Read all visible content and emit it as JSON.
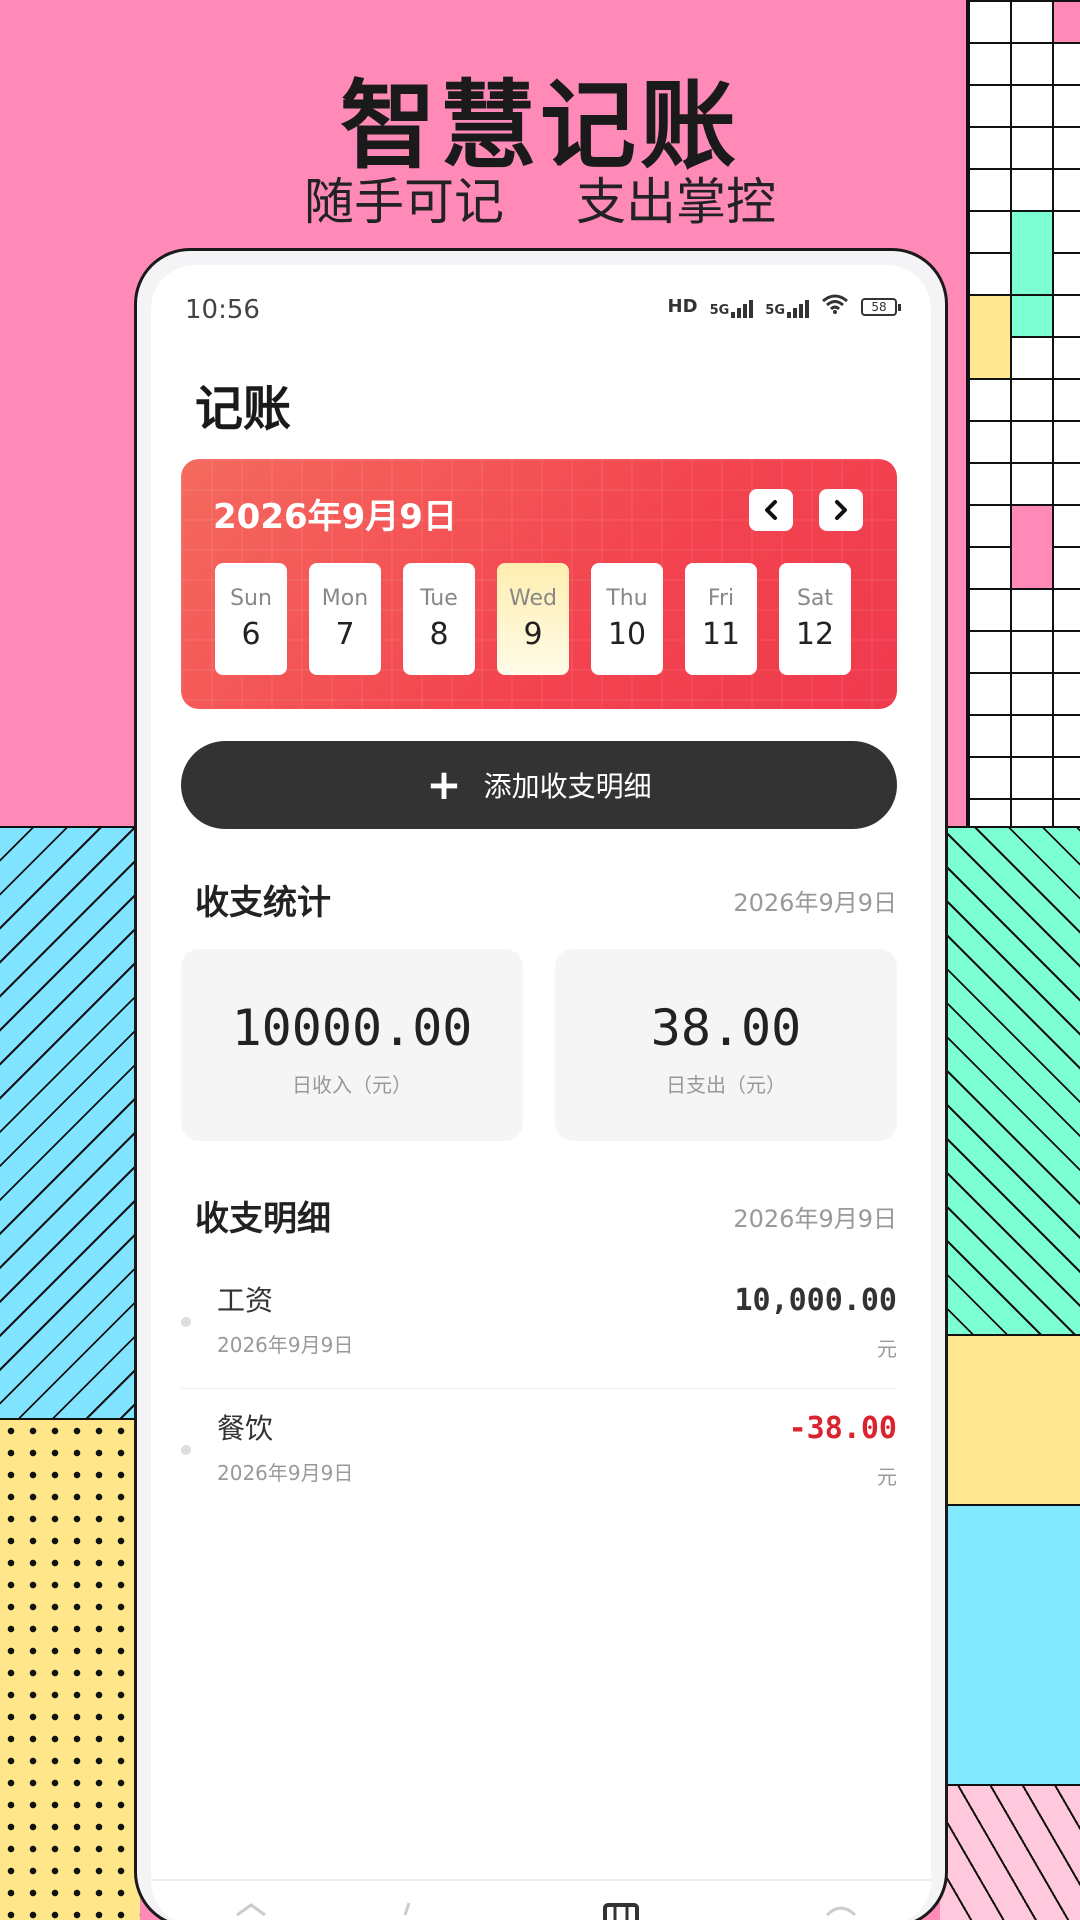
{
  "promo": {
    "headline": "智慧记账",
    "sub_left": "随手可记",
    "sub_right": "支出掌控"
  },
  "status_bar": {
    "time": "10:56",
    "hd_label": "HD",
    "net1": "5G",
    "net2": "5G",
    "battery": "58"
  },
  "page": {
    "title": "记账"
  },
  "calendar": {
    "date_label": "2026年9月9日",
    "days": [
      {
        "name": "Sun",
        "num": "6"
      },
      {
        "name": "Mon",
        "num": "7"
      },
      {
        "name": "Tue",
        "num": "8"
      },
      {
        "name": "Wed",
        "num": "9"
      },
      {
        "name": "Thu",
        "num": "10"
      },
      {
        "name": "Fri",
        "num": "11"
      },
      {
        "name": "Sat",
        "num": "12"
      }
    ]
  },
  "add_button": {
    "label": "添加收支明细"
  },
  "stats": {
    "title": "收支统计",
    "date": "2026年9月9日",
    "income_value": "10000.00",
    "income_label": "日收入（元）",
    "expense_value": "38.00",
    "expense_label": "日支出（元）"
  },
  "details": {
    "title": "收支明细",
    "date": "2026年9月9日",
    "items": [
      {
        "name": "工资",
        "date": "2026年9月9日",
        "amount": "10,000.00",
        "unit": "元",
        "color": "#333333"
      },
      {
        "name": "餐饮",
        "date": "2026年9月9日",
        "amount": "-38.00",
        "unit": "元",
        "color": "#d9232e"
      }
    ]
  },
  "colors": {
    "background_pink": "#ff8ab8",
    "card_red": "#f3434f",
    "button_dark": "#333333",
    "expense_red": "#d9232e"
  }
}
